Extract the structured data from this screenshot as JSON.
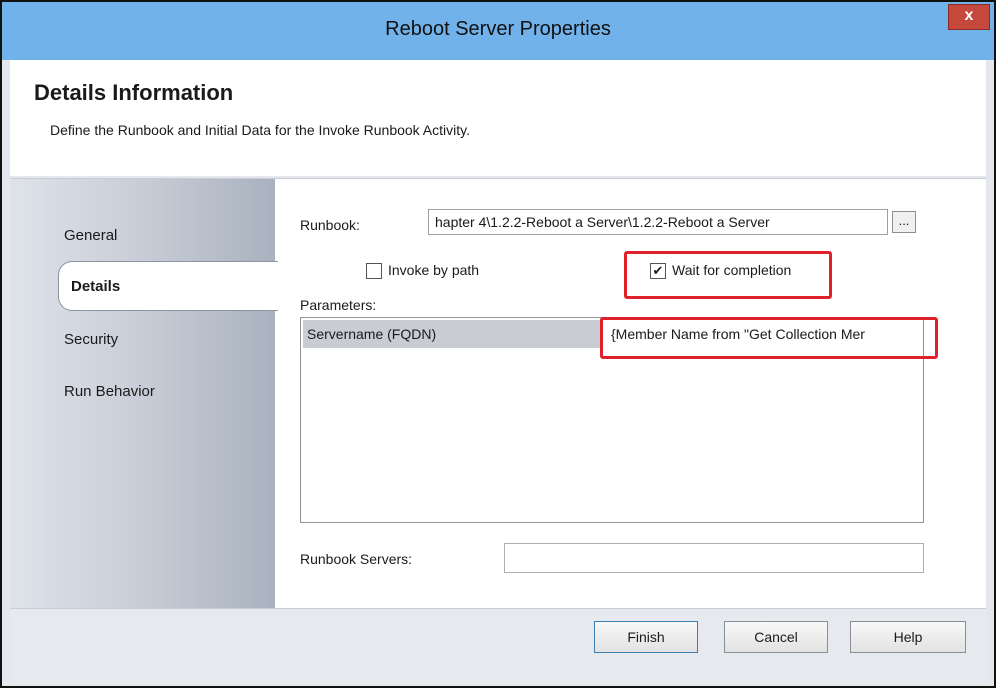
{
  "window": {
    "title": "Reboot Server  Properties",
    "close_glyph": "x"
  },
  "header": {
    "title": "Details Information",
    "subtitle": "Define the Runbook and Initial Data for the Invoke Runbook Activity."
  },
  "nav": {
    "items": [
      {
        "label": "General"
      },
      {
        "label": "Details",
        "selected": true
      },
      {
        "label": "Security"
      },
      {
        "label": "Run Behavior"
      }
    ]
  },
  "form": {
    "runbook_label": "Runbook:",
    "runbook_value": "hapter 4\\1.2.2-Reboot a Server\\1.2.2-Reboot a Server",
    "browse_label": "...",
    "invoke_by_path": {
      "label": "Invoke by path",
      "checked": false
    },
    "wait_for_completion": {
      "label": "Wait for completion",
      "checked": true
    },
    "parameters_label": "Parameters:",
    "parameters": [
      {
        "name": "Servername (FQDN)",
        "value": "{Member Name from \"Get Collection Mer"
      }
    ],
    "runbook_servers_label": "Runbook Servers:",
    "runbook_servers_value": ""
  },
  "footer": {
    "finish_label": "Finish",
    "cancel_label": "Cancel",
    "help_label": "Help"
  },
  "colors": {
    "titlebar": "#71b2ea",
    "highlight_box": "#e0202a",
    "close_button": "#c4483b"
  }
}
